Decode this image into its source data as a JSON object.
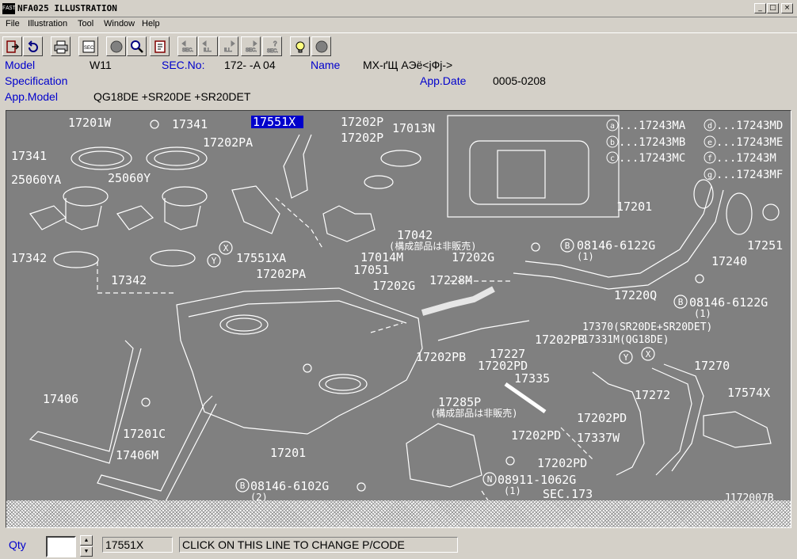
{
  "window": {
    "icon_text": "FAST",
    "title": "NFA025 ILLUSTRATION",
    "controls": [
      "_",
      "□",
      "×"
    ]
  },
  "menu": [
    "File",
    "Illustration",
    "Tool",
    "Window",
    "Help"
  ],
  "toolbar": {
    "buttons": [
      "exit-icon",
      "undo-icon",
      "print-icon",
      "sec-icon",
      "circle-icon",
      "zoom-icon",
      "book-icon",
      "sec-prev-icon",
      "ill-prev-icon",
      "ill-next-icon",
      "sec-next-icon",
      "sec-search-icon",
      "hint-icon",
      "stop-icon"
    ],
    "sec_label": "SEC.",
    "ill_label": "ILL."
  },
  "header": {
    "model_label": "Model",
    "model_value": "W11",
    "sec_label": "SEC.No:",
    "sec_value": "172-  -A 04",
    "name_label": "Name",
    "name_value": "МХ-ґЩ АЭё<јФј->",
    "spec_label": "Specification",
    "appdate_label": "App.Date",
    "appdate_value": "0005-0208",
    "appmodel_label": "App.Model",
    "appmodel_value": "QG18DE +SR20DE +SR20DET"
  },
  "illustration": {
    "labels": {
      "p17201W": "17201W",
      "p17341a": "17341",
      "p17341b": "17341",
      "p17551X": "17551X",
      "p17202P_1": "17202P",
      "p17202P_2": "17202P",
      "p17013N": "17013N",
      "p17202PA_1": "17202PA",
      "p17202PA_2": "17202PA",
      "p25060YA": "25060YA",
      "p25060Y": "25060Y",
      "p17342a": "17342",
      "p17342b": "17342",
      "p17551XA": "17551XA",
      "p17042": "17042",
      "p17042_note": "(構成部品は非販売)",
      "p17014M": "17014M",
      "p17051": "17051",
      "p17202G_1": "17202G",
      "p17202G_2": "17202G",
      "p17228M": "17228M",
      "p17201": "17201",
      "p17201_b": "17201",
      "b08146_6122G_1": "08146-6122G",
      "q1a": "(1)",
      "b08146_6122G_2": "08146-6122G",
      "q1b": "(1)",
      "p17220Q": "17220Q",
      "p17240": "17240",
      "p17251": "17251",
      "p17202PB_1": "17202PB",
      "p17202PB_2": "17202PB",
      "p17227": "17227",
      "p17370": "17370(SR20DE+SR20DET)",
      "p17331M": "17331M(QG18DE)",
      "p17270": "17270",
      "p17574X": "17574X",
      "p17202PD_1": "17202PD",
      "p17202PD_2": "17202PD",
      "p17202PD_3": "17202PD",
      "p17202PD_4": "17202PD",
      "p17335": "17335",
      "p17272": "17272",
      "p17337W": "17337W",
      "p17285P": "17285P",
      "p17285P_note": "(構成部品は非販売)",
      "p17406": "17406",
      "p17406M": "17406M",
      "p17201C": "17201C",
      "b08146_6102G": "08146-6102G",
      "q2": "(2)",
      "n08911_1062G": "08911-1062G",
      "q1c": "(1)",
      "sec173": "SEC.173",
      "ref": "J172007B"
    },
    "legend": [
      {
        "key": "a",
        "code": "...17243MA"
      },
      {
        "key": "b",
        "code": "...17243MB"
      },
      {
        "key": "c",
        "code": "...17243MC"
      },
      {
        "key": "d",
        "code": "...17243MD"
      },
      {
        "key": "e",
        "code": "...17243ME"
      },
      {
        "key": "f",
        "code": "...17243M"
      },
      {
        "key": "g",
        "code": "...17243MF"
      }
    ],
    "callouts": {
      "x": "X",
      "y": "Y",
      "b": "B",
      "n": "N"
    }
  },
  "status": {
    "qty_label": "Qty",
    "part_no": "17551X",
    "hint": "CLICK ON THIS LINE TO CHANGE P/CODE"
  }
}
